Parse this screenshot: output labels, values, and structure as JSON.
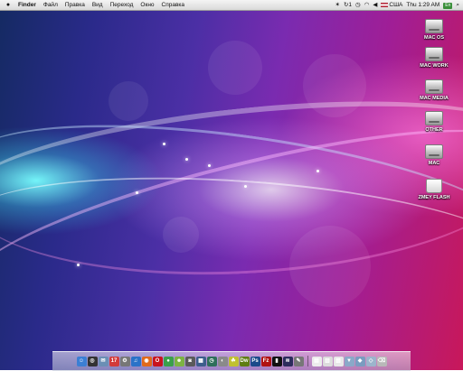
{
  "menubar": {
    "apple_icon": "apple-icon",
    "app_name": "Finder",
    "items": [
      "Файл",
      "Правка",
      "Вид",
      "Переход",
      "Окно",
      "Справка"
    ],
    "tray": {
      "icons": [
        "bluetooth-icon",
        "sync-icon",
        "time-machine-icon",
        "wifi-icon",
        "volume-icon",
        "flag-icon"
      ],
      "sync_count": "1",
      "locale": "США",
      "clock": "Thu 1:29 AM",
      "input_badge": "En",
      "search_icon": "spotlight-search-icon"
    }
  },
  "desktop": {
    "drives": [
      {
        "label": "MAC OS",
        "icon": "hard-drive-icon"
      },
      {
        "label": "MAC WORK",
        "icon": "hard-drive-icon"
      },
      {
        "label": "MAC MEDIA",
        "icon": "hard-drive-icon"
      },
      {
        "label": "OTHER",
        "icon": "hard-drive-icon"
      },
      {
        "label": "MAC",
        "icon": "hard-drive-icon"
      },
      {
        "label": "ZMEY FLASH",
        "icon": "usb-drive-icon"
      }
    ]
  },
  "dock": {
    "apps": [
      {
        "name": "finder-icon",
        "glyph": "☺",
        "color": "#3b7fd4"
      },
      {
        "name": "dashboard-icon",
        "glyph": "◎",
        "color": "#333333"
      },
      {
        "name": "mail-icon",
        "glyph": "✉",
        "color": "#6b8fb5"
      },
      {
        "name": "ical-icon",
        "glyph": "17",
        "color": "#d23b3b"
      },
      {
        "name": "system-preferences-icon",
        "glyph": "⚙",
        "color": "#777777"
      },
      {
        "name": "itunes-icon",
        "glyph": "♫",
        "color": "#2a72c8"
      },
      {
        "name": "firefox-icon",
        "glyph": "◉",
        "color": "#e06a1b"
      },
      {
        "name": "opera-icon",
        "glyph": "O",
        "color": "#c8141e"
      },
      {
        "name": "chrome-icon",
        "glyph": "●",
        "color": "#3aa04a"
      },
      {
        "name": "adium-icon",
        "glyph": "☻",
        "color": "#7cb342"
      },
      {
        "name": "photo-booth-icon",
        "glyph": "◙",
        "color": "#5a5a5a"
      },
      {
        "name": "spaces-icon",
        "glyph": "▦",
        "color": "#3d5e8c"
      },
      {
        "name": "time-machine-icon",
        "glyph": "◷",
        "color": "#2f6f5a"
      },
      {
        "name": "preview-icon",
        "glyph": "◐",
        "color": "#8a8a8a"
      },
      {
        "name": "coda-icon",
        "glyph": "☘",
        "color": "#c0c030"
      },
      {
        "name": "dreamweaver-icon",
        "glyph": "Dw",
        "color": "#5e7d12"
      },
      {
        "name": "photoshop-icon",
        "glyph": "Ps",
        "color": "#1c4a8a"
      },
      {
        "name": "filezilla-icon",
        "glyph": "Fz",
        "color": "#b01212"
      },
      {
        "name": "terminal-icon",
        "glyph": "▮",
        "color": "#111111"
      },
      {
        "name": "activity-monitor-icon",
        "glyph": "≋",
        "color": "#2c2c5c"
      },
      {
        "name": "script-editor-icon",
        "glyph": "✎",
        "color": "#777777"
      }
    ],
    "others": [
      {
        "name": "document-stack-icon",
        "glyph": "▤",
        "color": "#ececec"
      },
      {
        "name": "text-document-icon",
        "glyph": "▥",
        "color": "#dcdcdc"
      },
      {
        "name": "notes-icon",
        "glyph": "▧",
        "color": "#e8e8e8"
      },
      {
        "name": "downloads-folder-icon",
        "glyph": "▼",
        "color": "#8aa9c8"
      },
      {
        "name": "applications-folder-icon",
        "glyph": "◆",
        "color": "#7a9cc0"
      },
      {
        "name": "network-folder-icon",
        "glyph": "◇",
        "color": "#9cb4cc"
      },
      {
        "name": "trash-icon",
        "glyph": "⌫",
        "color": "#b8b8b8"
      }
    ]
  }
}
